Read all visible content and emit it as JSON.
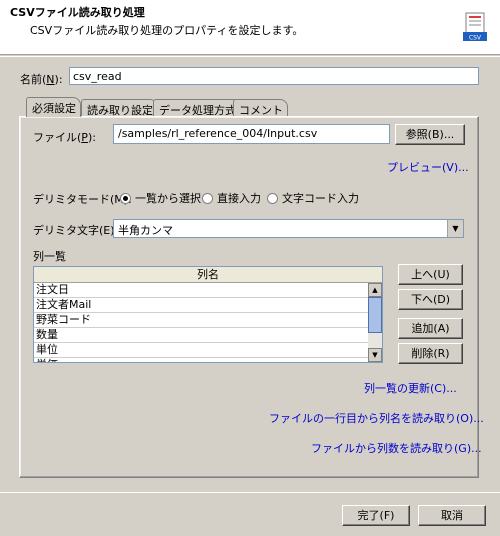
{
  "header": {
    "title": "CSVファイル読み取り処理",
    "description": "CSVファイル読み取り処理のプロパティを設定します。",
    "icon_label": "CSV"
  },
  "name": {
    "label_prefix": "名前(",
    "mnemonic": "N",
    "label_suffix": "):",
    "value": "csv_read"
  },
  "tabs": [
    {
      "label": "必須設定",
      "active": true
    },
    {
      "label": "読み取り設定",
      "active": false
    },
    {
      "label": "データ処理方式",
      "active": false
    },
    {
      "label": "コメント",
      "active": false
    }
  ],
  "file": {
    "label_prefix": "ファイル(",
    "mnemonic": "P",
    "label_suffix": "):",
    "value": "/samples/rl_reference_004/Input.csv",
    "browse_button": "参照(B)..."
  },
  "preview_link": "プレビュー(V)...",
  "delimiter_mode": {
    "label": "デリミタモード(M):",
    "options": [
      "一覧から選択",
      "直接入力",
      "文字コード入力"
    ],
    "selected": "一覧から選択"
  },
  "delimiter_char": {
    "label": "デリミタ文字(E):",
    "value": "半角カンマ"
  },
  "columns": {
    "section_label": "列一覧",
    "header": "列名",
    "rows": [
      "注文日",
      "注文者Mail",
      "野菜コード",
      "数量",
      "単位",
      "単価"
    ]
  },
  "column_buttons": {
    "up": "上へ(U)",
    "down": "下へ(D)",
    "add": "追加(A)",
    "delete": "削除(R)"
  },
  "links": {
    "refresh": "列一覧の更新(C)...",
    "read_names": "ファイルの一行目から列名を読み取り(O)...",
    "read_count": "ファイルから列数を読み取り(G)..."
  },
  "footer": {
    "finish": "完了(F)",
    "cancel": "取消"
  }
}
